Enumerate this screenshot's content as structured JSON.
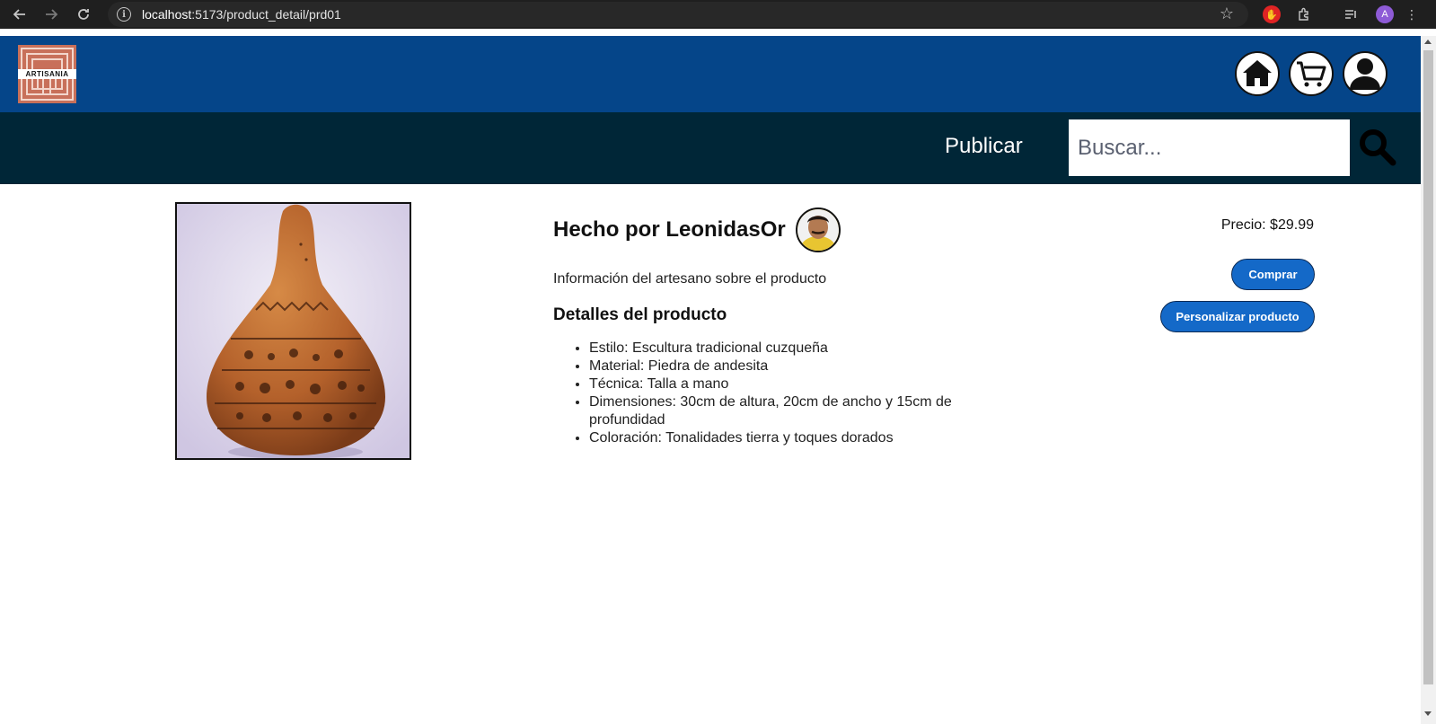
{
  "browser": {
    "url_host": "localhost",
    "url_path": ":5173/product_detail/prd01",
    "profile_initial": "A",
    "nav_icons": [
      "back-arrow-icon",
      "forward-arrow-icon",
      "reload-icon"
    ]
  },
  "header": {
    "logo_text": "ARTISANIA",
    "icons": [
      "home-icon",
      "cart-icon",
      "user-icon"
    ]
  },
  "nav": {
    "publish_label": "Publicar",
    "search_placeholder": "Buscar..."
  },
  "product": {
    "maker_title": "Hecho por LeonidasOr",
    "about": "Información del artesano sobre el producto",
    "details_title": "Detalles del producto",
    "details": [
      "Estilo: Escultura tradicional cuzqueña",
      "Material: Piedra de andesita",
      "Técnica: Talla a mano",
      "Dimensiones: 30cm de altura, 20cm de ancho y 15cm de profundidad",
      "Coloración: Tonalidades tierra y toques dorados"
    ],
    "price": "Precio: $29.99",
    "buy_label": "Comprar",
    "customize_label": "Personalizar producto"
  },
  "colors": {
    "header_bg": "#054589",
    "nav_bg": "#002637",
    "button_bg": "#1469c8",
    "logo_bg": "#c8705a"
  }
}
